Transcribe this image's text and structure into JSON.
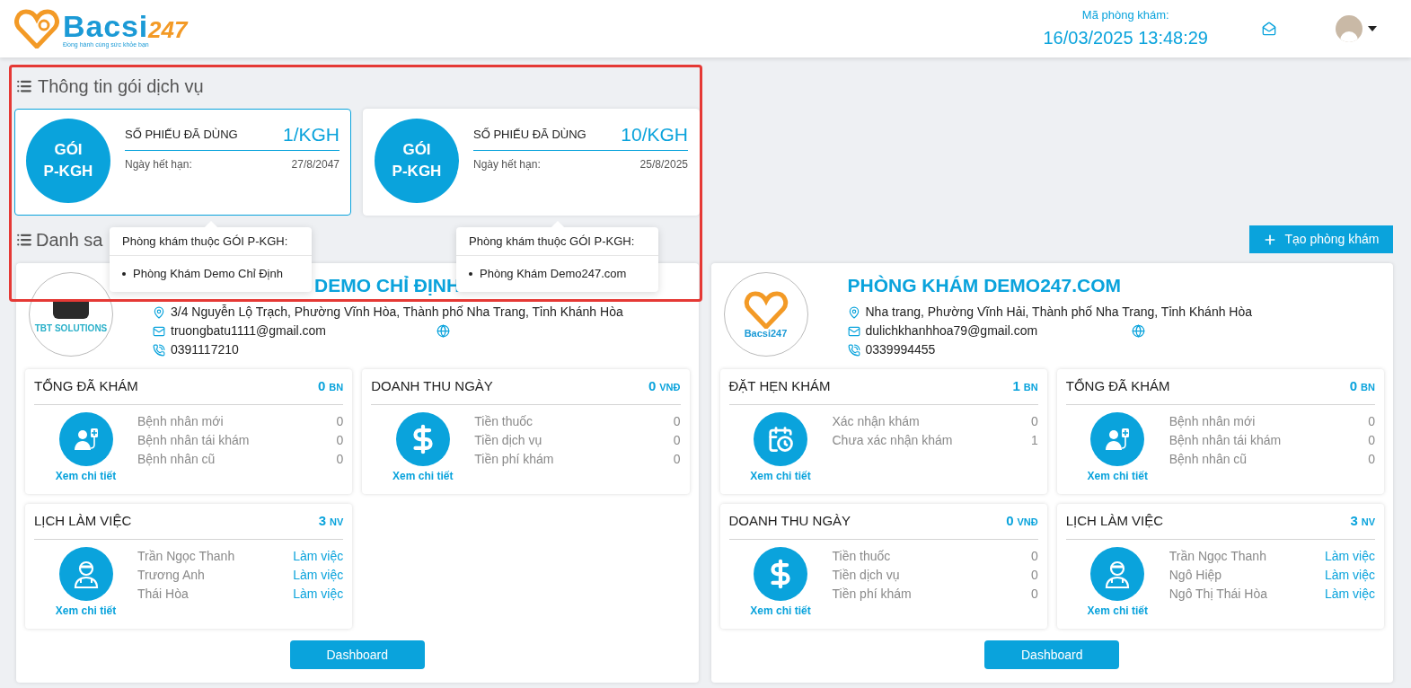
{
  "header": {
    "logo": {
      "name": "Bacsi",
      "suffix": "247",
      "tagline": "Đồng hành cùng sức khỏe bạn"
    },
    "clinic_code_label": "Mã phòng khám:",
    "datetime": "16/03/2025 13:48:29"
  },
  "packages_section": {
    "title": "Thông tin gói dịch vụ",
    "highlighted": true,
    "packages": [
      {
        "badge_line1": "GÓI",
        "badge_line2": "P-KGH",
        "used_label": "SỐ PHIẾU ĐÃ DÙNG",
        "used_value": "1/KGH",
        "expiry_label": "Ngày hết hạn:",
        "expiry_date": "27/8/2047",
        "selected": true,
        "tooltip": {
          "title": "Phòng khám thuộc GÓI P-KGH:",
          "items": [
            "Phòng Khám Demo Chỉ Định"
          ]
        }
      },
      {
        "badge_line1": "GÓI",
        "badge_line2": "P-KGH",
        "used_label": "SỐ PHIẾU ĐÃ DÙNG",
        "used_value": "10/KGH",
        "expiry_label": "Ngày hết hạn:",
        "expiry_date": "25/8/2025",
        "selected": false,
        "tooltip": {
          "title": "Phòng khám thuộc GÓI P-KGH:",
          "items": [
            "Phòng Khám Demo247.com"
          ]
        }
      }
    ]
  },
  "clinics_section": {
    "title": "Danh sa",
    "create_button": "Tạo phòng khám",
    "clinics": [
      {
        "kind": "tbt",
        "logo_text": "TBT SOLUTIONS",
        "name": "DEMO CHỈ ĐỊNH",
        "address": "3/4 Nguyễn Lộ Trạch, Phường Vĩnh Hòa, Thành phố Nha Trang, Tỉnh Khánh Hòa",
        "email": "truongbatu1111@gmail.com",
        "phone": "0391117210",
        "dashboard_button": "Dashboard",
        "stats": [
          {
            "kind": "patients",
            "title": "TỔNG ĐÃ KHÁM",
            "count": "0",
            "unit": "BN",
            "link": "Xem chi tiết",
            "rows": [
              {
                "label": "Bệnh nhân mới",
                "value": "0"
              },
              {
                "label": "Bệnh nhân tái khám",
                "value": "0"
              },
              {
                "label": "Bệnh nhân cũ",
                "value": "0"
              }
            ]
          },
          {
            "kind": "revenue",
            "title": "DOANH THU NGÀY",
            "count": "0",
            "unit": "VNĐ",
            "link": "Xem chi tiết",
            "rows": [
              {
                "label": "Tiền thuốc",
                "value": "0"
              },
              {
                "label": "Tiền dịch vụ",
                "value": "0"
              },
              {
                "label": "Tiền phí khám",
                "value": "0"
              }
            ]
          },
          {
            "kind": "schedule",
            "title": "LỊCH LÀM VIỆC",
            "count": "3",
            "unit": "NV",
            "link": "Xem chi tiết",
            "rows": [
              {
                "label": "Trần Ngọc Thanh",
                "value": "Làm việc"
              },
              {
                "label": "Trương Anh",
                "value": "Làm việc"
              },
              {
                "label": "Thái Hòa",
                "value": "Làm việc"
              }
            ]
          }
        ]
      },
      {
        "kind": "bacsi",
        "logo_text": "Bacsi247",
        "name": "PHÒNG KHÁM DEMO247.COM",
        "address": "Nha trang, Phường Vĩnh Hải, Thành phố Nha Trang, Tỉnh Khánh Hòa",
        "email": "dulichkhanhhoa79@gmail.com",
        "phone": "0339994455",
        "dashboard_button": "Dashboard",
        "stats": [
          {
            "kind": "appointments",
            "title": "ĐẶT HẸN KHÁM",
            "count": "1",
            "unit": "BN",
            "link": "Xem chi tiết",
            "rows": [
              {
                "label": "Xác nhận khám",
                "value": "0"
              },
              {
                "label": "Chưa xác nhận khám",
                "value": "1"
              }
            ]
          },
          {
            "kind": "patients",
            "title": "TỔNG ĐÃ KHÁM",
            "count": "0",
            "unit": "BN",
            "link": "Xem chi tiết",
            "rows": [
              {
                "label": "Bệnh nhân mới",
                "value": "0"
              },
              {
                "label": "Bệnh nhân tái khám",
                "value": "0"
              },
              {
                "label": "Bệnh nhân cũ",
                "value": "0"
              }
            ]
          },
          {
            "kind": "revenue",
            "title": "DOANH THU NGÀY",
            "count": "0",
            "unit": "VNĐ",
            "link": "Xem chi tiết",
            "rows": [
              {
                "label": "Tiền thuốc",
                "value": "0"
              },
              {
                "label": "Tiền dịch vụ",
                "value": "0"
              },
              {
                "label": "Tiền phí khám",
                "value": "0"
              }
            ]
          },
          {
            "kind": "schedule",
            "title": "LỊCH LÀM VIỆC",
            "count": "3",
            "unit": "NV",
            "link": "Xem chi tiết",
            "rows": [
              {
                "label": "Trần Ngọc Thanh",
                "value": "Làm việc"
              },
              {
                "label": "Ngô Hiệp",
                "value": "Làm việc"
              },
              {
                "label": "Ngô Thị Thái Hòa",
                "value": "Làm việc"
              }
            ]
          }
        ]
      }
    ]
  }
}
